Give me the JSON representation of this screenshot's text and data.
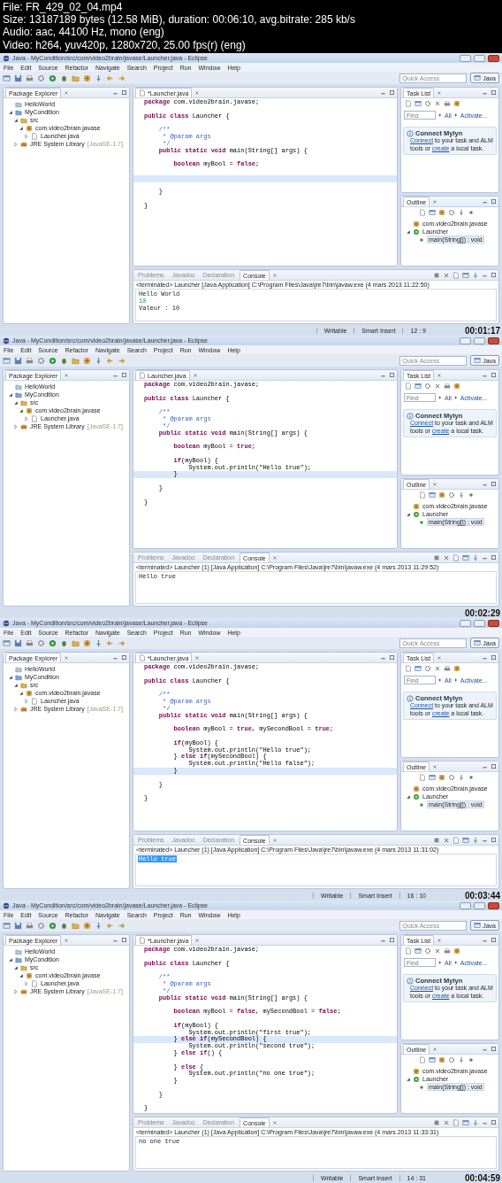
{
  "file_info": [
    "File: FR_429_02_04.mp4",
    "Size: 13187189 bytes (12.58 MiB), duration: 00:06:10, avg.bitrate: 285 kb/s",
    "Audio: aac, 44100 Hz, mono (eng)",
    "Video: h264, yuv420p, 1280x720, 25.00 fps(r) (eng)"
  ],
  "frames": [
    {
      "window_title": "Java - MyCondition/src/com/video2brain/javase/Launcher.java - Eclipse",
      "menu": [
        "File",
        "Edit",
        "Source",
        "Refactor",
        "Navigate",
        "Search",
        "Project",
        "Run",
        "Window",
        "Help"
      ],
      "quick_access": {
        "placeholder": "Quick Access"
      },
      "perspective": "Java",
      "package_explorer": {
        "title": "Package Explorer",
        "tree": [
          {
            "kind": "closed-project",
            "label": "HelloWorld"
          },
          {
            "kind": "project",
            "label": "MyCondition",
            "expanded": true,
            "children": [
              {
                "kind": "folder",
                "label": "src",
                "expanded": true,
                "children": [
                  {
                    "kind": "package",
                    "label": "com.video2brain.javase",
                    "expanded": true,
                    "children": [
                      {
                        "kind": "file",
                        "label": "Launcher.java",
                        "expanded": false
                      }
                    ]
                  }
                ]
              },
              {
                "kind": "library",
                "label": "JRE System Library",
                "decoration": "[JavaSE-1.7]",
                "expanded": false
              }
            ]
          }
        ]
      },
      "editor": {
        "tab": "*Launcher.java",
        "lines": [
          {
            "kind": "code",
            "text": "**package** com.video2brain.javase;",
            "current": false
          },
          {
            "kind": "gap",
            "current": false
          },
          {
            "kind": "code",
            "text": "**public** **class** Launcher {",
            "current": false
          },
          {
            "kind": "gap",
            "current": false
          },
          {
            "kind": "comment",
            "text": "    /**",
            "current": false
          },
          {
            "kind": "comment",
            "text": "     * @param args",
            "current": false
          },
          {
            "kind": "comment",
            "text": "     */",
            "current": false
          },
          {
            "kind": "code",
            "text": "    **public** **static** **void** main(String[] args) {",
            "current": false
          },
          {
            "kind": "gap",
            "current": false
          },
          {
            "kind": "code",
            "text": "        **boolean** myBool = **false**;",
            "current": false
          },
          {
            "kind": "gap",
            "current": false
          },
          {
            "kind": "gap",
            "current": true
          },
          {
            "kind": "gap",
            "current": false
          },
          {
            "kind": "code",
            "text": "    }",
            "current": false
          },
          {
            "kind": "gap",
            "current": false
          },
          {
            "kind": "code",
            "text": "}",
            "current": false
          }
        ]
      },
      "task_list": {
        "title": "Task List",
        "find": {
          "placeholder": "Find"
        },
        "links": [
          "All",
          "Activate..."
        ]
      },
      "mylyn": {
        "title": "Connect Mylyn",
        "message": [
          {
            "text": "Connect",
            "link": true
          },
          {
            "text": " to your task and ALM tools or ",
            "link": false
          },
          {
            "text": "create",
            "link": true
          },
          {
            "text": " a local task.",
            "link": false
          }
        ]
      },
      "outline": {
        "title": "Outline",
        "tree": [
          {
            "kind": "package",
            "label": "com.video2brain.javase",
            "selected": false
          },
          {
            "kind": "class",
            "label": "Launcher",
            "expanded": true,
            "selected": false,
            "children": [
              {
                "kind": "method",
                "label": "main(String[]) : void",
                "selected": true
              }
            ]
          }
        ]
      },
      "console": {
        "tabs": [
          {
            "label": "Problems",
            "selected": false
          },
          {
            "label": "Javadoc",
            "selected": false
          },
          {
            "label": "Declaration",
            "selected": false
          },
          {
            "label": "Console",
            "selected": true
          }
        ],
        "header": "<terminated> Launcher [Java Application] C:\\Program Files\\Java\\jre7\\bin\\javaw.exe (4 mars 2013 11:22:50)",
        "lines": [
          {
            "kind": "output",
            "text": "Hello World",
            "selected": false
          },
          {
            "kind": "input",
            "text": "10",
            "selected": false
          },
          {
            "kind": "output",
            "text": "Valeur : 10",
            "selected": false
          }
        ]
      },
      "status": [
        "Writable",
        "Smart Insert",
        "12 : 9"
      ],
      "timestamp": "00:01:17"
    },
    {
      "window_title": "Java - MyCondition/src/com/video2brain/javase/Launcher.java - Eclipse",
      "menu": [
        "File",
        "Edit",
        "Source",
        "Refactor",
        "Navigate",
        "Search",
        "Project",
        "Run",
        "Window",
        "Help"
      ],
      "quick_access": {
        "placeholder": "Quick Access"
      },
      "perspective": "Java",
      "package_explorer": {
        "title": "Package Explorer",
        "tree": [
          {
            "kind": "closed-project",
            "label": "HelloWorld"
          },
          {
            "kind": "project",
            "label": "MyCondition",
            "expanded": true,
            "children": [
              {
                "kind": "folder",
                "label": "src",
                "expanded": true,
                "children": [
                  {
                    "kind": "package",
                    "label": "com.video2brain.javase",
                    "expanded": true,
                    "children": [
                      {
                        "kind": "file",
                        "label": "Launcher.java",
                        "expanded": false
                      }
                    ]
                  }
                ]
              },
              {
                "kind": "library",
                "label": "JRE System Library",
                "decoration": "[JavaSE-1.7]",
                "expanded": false
              }
            ]
          }
        ]
      },
      "editor": {
        "tab": "Launcher.java",
        "lines": [
          {
            "kind": "code",
            "text": "**package** com.video2brain.javase;",
            "current": false
          },
          {
            "kind": "gap",
            "current": false
          },
          {
            "kind": "code",
            "text": "**public** **class** Launcher {",
            "current": false
          },
          {
            "kind": "gap",
            "current": false
          },
          {
            "kind": "comment",
            "text": "    /**",
            "current": false
          },
          {
            "kind": "comment",
            "text": "     * @param args",
            "current": false
          },
          {
            "kind": "comment",
            "text": "     */",
            "current": false
          },
          {
            "kind": "code",
            "text": "    **public** **static** **void** main(String[] args) {",
            "current": false
          },
          {
            "kind": "gap",
            "current": false
          },
          {
            "kind": "code",
            "text": "        **boolean** myBool = **true**;",
            "current": false
          },
          {
            "kind": "gap",
            "current": false
          },
          {
            "kind": "code",
            "text": "        **if**(myBool) {",
            "current": false
          },
          {
            "kind": "code",
            "text": "            System.out.println(\"Hello true\");",
            "current": false
          },
          {
            "kind": "code",
            "text": "        }",
            "current": true
          },
          {
            "kind": "gap",
            "current": false
          },
          {
            "kind": "code",
            "text": "    }",
            "current": false
          },
          {
            "kind": "gap",
            "current": false
          },
          {
            "kind": "code",
            "text": "}",
            "current": false
          }
        ]
      },
      "task_list": {
        "title": "Task List",
        "find": {
          "placeholder": "Find"
        },
        "links": [
          "All",
          "Activate..."
        ]
      },
      "mylyn": {
        "title": "Connect Mylyn",
        "message": [
          {
            "text": "Connect",
            "link": true
          },
          {
            "text": " to your task and ALM tools or ",
            "link": false
          },
          {
            "text": "create",
            "link": true
          },
          {
            "text": " a local task.",
            "link": false
          }
        ]
      },
      "outline": {
        "title": "Outline",
        "tree": [
          {
            "kind": "package",
            "label": "com.video2brain.javase",
            "selected": false
          },
          {
            "kind": "class",
            "label": "Launcher",
            "expanded": true,
            "selected": false,
            "children": [
              {
                "kind": "method",
                "label": "main(String[]) : void",
                "selected": true
              }
            ]
          }
        ]
      },
      "console": {
        "tabs": [
          {
            "label": "Problems",
            "selected": false
          },
          {
            "label": "Javadoc",
            "selected": false
          },
          {
            "label": "Declaration",
            "selected": false
          },
          {
            "label": "Console",
            "selected": true
          }
        ],
        "header": "<terminated> Launcher (1) [Java Application] C:\\Program Files\\Java\\jre7\\bin\\javaw.exe (4 mars 2013 11:29:52)",
        "lines": [
          {
            "kind": "output",
            "text": "Hello true",
            "selected": false
          }
        ]
      },
      "timestamp": "00:02:29"
    },
    {
      "window_title": "Java - MyCondition/src/com/video2brain/javase/Launcher.java - Eclipse",
      "menu": [
        "File",
        "Edit",
        "Source",
        "Refactor",
        "Navigate",
        "Search",
        "Project",
        "Run",
        "Window",
        "Help"
      ],
      "quick_access": {
        "placeholder": "Quick Access"
      },
      "perspective": "Java",
      "package_explorer": {
        "title": "Package Explorer",
        "tree": [
          {
            "kind": "closed-project",
            "label": "HelloWorld"
          },
          {
            "kind": "project",
            "label": "MyCondition",
            "expanded": true,
            "children": [
              {
                "kind": "folder",
                "label": "src",
                "expanded": true,
                "children": [
                  {
                    "kind": "package",
                    "label": "com.video2brain.javase",
                    "expanded": true,
                    "children": [
                      {
                        "kind": "file",
                        "label": "Launcher.java",
                        "expanded": false
                      }
                    ]
                  }
                ]
              },
              {
                "kind": "library",
                "label": "JRE System Library",
                "decoration": "[JavaSE-1.7]",
                "expanded": false
              }
            ]
          }
        ]
      },
      "editor": {
        "tab": "*Launcher.java",
        "lines": [
          {
            "kind": "code",
            "text": "**package** com.video2brain.javase;",
            "current": false
          },
          {
            "kind": "gap",
            "current": false
          },
          {
            "kind": "code",
            "text": "**public** **class** Launcher {",
            "current": false
          },
          {
            "kind": "gap",
            "current": false
          },
          {
            "kind": "comment",
            "text": "    /**",
            "current": false
          },
          {
            "kind": "comment",
            "text": "     * @param args",
            "current": false
          },
          {
            "kind": "comment",
            "text": "     */",
            "current": false
          },
          {
            "kind": "code",
            "text": "    **public** **static** **void** main(String[] args) {",
            "current": false
          },
          {
            "kind": "gap",
            "current": false
          },
          {
            "kind": "code",
            "text": "        **boolean** myBool = **true**, mySecondBool = **true**;",
            "current": false
          },
          {
            "kind": "gap",
            "current": false
          },
          {
            "kind": "code",
            "text": "        **if**(myBool) {",
            "current": false
          },
          {
            "kind": "code",
            "text": "            System.out.println(\"Hello true\");",
            "current": false
          },
          {
            "kind": "code",
            "text": "        } **else** **if**(mySecondBool) {",
            "current": false
          },
          {
            "kind": "code",
            "text": "            System.out.println(\"Hello false\");",
            "current": false
          },
          {
            "kind": "code",
            "text": "        }",
            "current": true
          },
          {
            "kind": "gap",
            "current": false
          },
          {
            "kind": "code",
            "text": "    }",
            "current": false
          },
          {
            "kind": "gap",
            "current": false
          },
          {
            "kind": "code",
            "text": "}",
            "current": false
          }
        ]
      },
      "task_list": {
        "title": "Task List",
        "find": {
          "placeholder": "Find"
        },
        "links": [
          "All",
          "Activate..."
        ]
      },
      "mylyn": {
        "title": "Connect Mylyn",
        "message": [
          {
            "text": "Connect",
            "link": true
          },
          {
            "text": " to your task and ALM tools or ",
            "link": false
          },
          {
            "text": "create",
            "link": true
          },
          {
            "text": " a local task.",
            "link": false
          }
        ]
      },
      "outline": {
        "title": "Outline",
        "tree": [
          {
            "kind": "package",
            "label": "com.video2brain.javase",
            "selected": false
          },
          {
            "kind": "class",
            "label": "Launcher",
            "expanded": true,
            "selected": false,
            "children": [
              {
                "kind": "method",
                "label": "main(String[]) : void",
                "selected": true
              }
            ]
          }
        ]
      },
      "console": {
        "tabs": [
          {
            "label": "Problems",
            "selected": false
          },
          {
            "label": "Javadoc",
            "selected": false
          },
          {
            "label": "Declaration",
            "selected": false
          },
          {
            "label": "Console",
            "selected": true
          }
        ],
        "header": "<terminated> Launcher (1) [Java Application] C:\\Program Files\\Java\\jre7\\bin\\javaw.exe (4 mars 2013 11:31:02)",
        "lines": [
          {
            "kind": "output",
            "text": "Hello true",
            "selected": true
          }
        ]
      },
      "status": [
        "Writable",
        "Smart Insert",
        "16 : 10"
      ],
      "timestamp": "00:03:44"
    },
    {
      "window_title": "Java - MyCondition/src/com/video2brain/javase/Launcher.java - Eclipse",
      "menu": [
        "File",
        "Edit",
        "Source",
        "Refactor",
        "Navigate",
        "Search",
        "Project",
        "Run",
        "Window",
        "Help"
      ],
      "quick_access": {
        "placeholder": "Quick Access"
      },
      "perspective": "Java",
      "package_explorer": {
        "title": "Package Explorer",
        "tree": [
          {
            "kind": "closed-project",
            "label": "HelloWorld"
          },
          {
            "kind": "project",
            "label": "MyCondition",
            "expanded": true,
            "children": [
              {
                "kind": "folder",
                "label": "src",
                "expanded": true,
                "children": [
                  {
                    "kind": "package",
                    "label": "com.video2brain.javase",
                    "expanded": true,
                    "children": [
                      {
                        "kind": "file",
                        "label": "Launcher.java",
                        "expanded": false
                      }
                    ]
                  }
                ]
              },
              {
                "kind": "library",
                "label": "JRE System Library",
                "decoration": "[JavaSE-1.7]",
                "expanded": false
              }
            ]
          }
        ]
      },
      "editor": {
        "tab": "*Launcher.java",
        "lines": [
          {
            "kind": "code",
            "text": "**package** com.video2brain.javase;",
            "current": false
          },
          {
            "kind": "gap",
            "current": false
          },
          {
            "kind": "code",
            "text": "**public** **class** Launcher {",
            "current": false
          },
          {
            "kind": "gap",
            "current": false
          },
          {
            "kind": "comment",
            "text": "    /**",
            "current": false
          },
          {
            "kind": "comment",
            "text": "     * @param args",
            "current": false
          },
          {
            "kind": "comment",
            "text": "     */",
            "current": false
          },
          {
            "kind": "code",
            "text": "    **public** **static** **void** main(String[] args) {",
            "current": false
          },
          {
            "kind": "gap",
            "current": false
          },
          {
            "kind": "code",
            "text": "        **boolean** myBool = **false**, mySecondBool = **false**;",
            "current": false
          },
          {
            "kind": "gap",
            "current": false
          },
          {
            "kind": "code",
            "text": "        **if**(myBool) {",
            "current": false
          },
          {
            "kind": "code",
            "text": "            System.out.println(\"first true\");",
            "current": false
          },
          {
            "kind": "code",
            "text": "        } **else** **if**(mySecondBool) {",
            "current": true
          },
          {
            "kind": "code",
            "text": "            System.out.println(\"second true\");",
            "current": false
          },
          {
            "kind": "code",
            "text": "        } **else** **if**() {",
            "current": false
          },
          {
            "kind": "gap",
            "current": false
          },
          {
            "kind": "code",
            "text": "        } **else** {",
            "current": false
          },
          {
            "kind": "code",
            "text": "            System.out.println(\"no one true\");",
            "current": false
          },
          {
            "kind": "code",
            "text": "        }",
            "current": false
          },
          {
            "kind": "gap",
            "current": false
          },
          {
            "kind": "code",
            "text": "    }",
            "current": false
          },
          {
            "kind": "gap",
            "current": false
          },
          {
            "kind": "code",
            "text": "}",
            "current": false
          }
        ]
      },
      "task_list": {
        "title": "Task List",
        "find": {
          "placeholder": "Find"
        },
        "links": [
          "All",
          "Activate..."
        ]
      },
      "mylyn": {
        "title": "Connect Mylyn",
        "message": [
          {
            "text": "Connect",
            "link": true
          },
          {
            "text": " to your task and ALM tools or ",
            "link": false
          },
          {
            "text": "create",
            "link": true
          },
          {
            "text": " a local task.",
            "link": false
          }
        ]
      },
      "outline": {
        "title": "Outline",
        "tree": [
          {
            "kind": "package",
            "label": "com.video2brain.javase",
            "selected": false
          },
          {
            "kind": "class",
            "label": "Launcher",
            "expanded": true,
            "selected": false,
            "children": [
              {
                "kind": "method",
                "label": "main(String[]) : void",
                "selected": true
              }
            ]
          }
        ]
      },
      "console": {
        "tabs": [
          {
            "label": "Problems",
            "selected": false
          },
          {
            "label": "Javadoc",
            "selected": false
          },
          {
            "label": "Declaration",
            "selected": false
          },
          {
            "label": "Console",
            "selected": true
          }
        ],
        "header": "<terminated> Launcher (1) [Java Application] C:\\Program Files\\Java\\jre7\\bin\\javaw.exe (4 mars 2013 11:33:31)",
        "lines": [
          {
            "kind": "output",
            "text": "no one true",
            "selected": false
          }
        ]
      },
      "status": [
        "Writable",
        "Smart Insert",
        "14 : 31"
      ],
      "timestamp": "00:04:59"
    }
  ]
}
